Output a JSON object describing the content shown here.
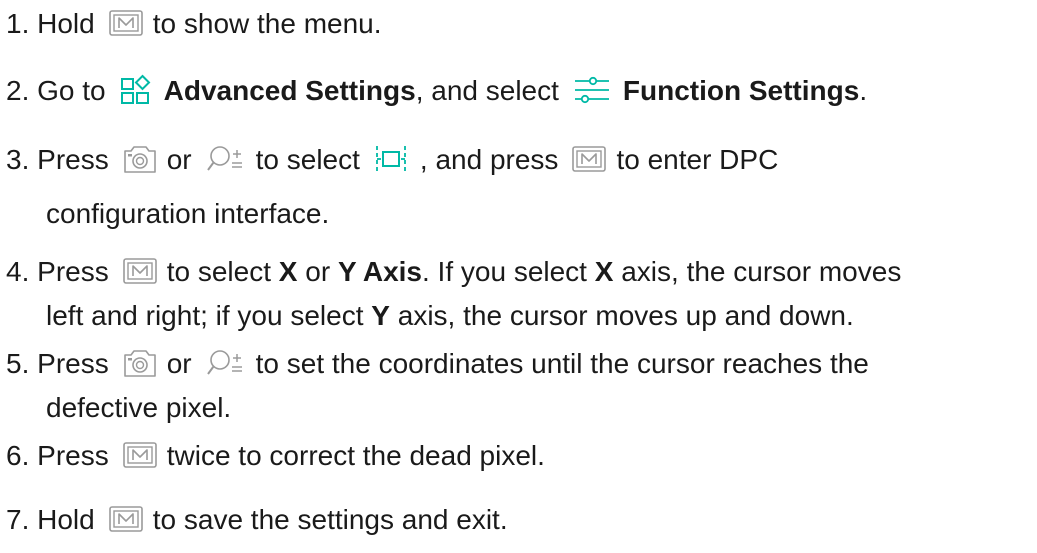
{
  "colors": {
    "text": "#1a1a1a",
    "icon_gray": "#9a9a9a",
    "accent": "#00b9a6"
  },
  "icons": {
    "menu_button": "m-button-icon",
    "advanced_settings": "advanced-settings-icon",
    "function_settings": "sliders-icon",
    "capture": "camera-icon",
    "zoom": "zoom-icon",
    "dpc": "dpc-icon"
  },
  "steps": [
    {
      "num": "1.",
      "t1": "Hold",
      "t2": "to show the menu."
    },
    {
      "num": "2.",
      "t1": "Go to",
      "b1": "Advanced Settings",
      "t2": ", and select",
      "b2": "Function Settings",
      "t3": "."
    },
    {
      "num": "3.",
      "t1": "Press",
      "t2": "or",
      "t3": "to select",
      "t4": ", and press",
      "t5": "to enter DPC",
      "cont": "configuration interface."
    },
    {
      "num": "4.",
      "t1": "Press",
      "t2": "to select",
      "b1": "X",
      "t3": "or",
      "b2": "Y Axis",
      "t4": ". If you select",
      "b3": "X",
      "t5": "axis, the cursor moves",
      "cont1": "left and right; if you select",
      "b4": "Y",
      "cont2": "axis, the cursor moves up and down."
    },
    {
      "num": "5.",
      "t1": "Press",
      "t2": "or",
      "t3": "to set the coordinates until the cursor reaches the",
      "cont": "defective pixel."
    },
    {
      "num": "6.",
      "t1": "Press",
      "t2": "twice to correct the dead pixel."
    },
    {
      "num": "7.",
      "t1": "Hold",
      "t2": "to save the settings and exit."
    }
  ]
}
